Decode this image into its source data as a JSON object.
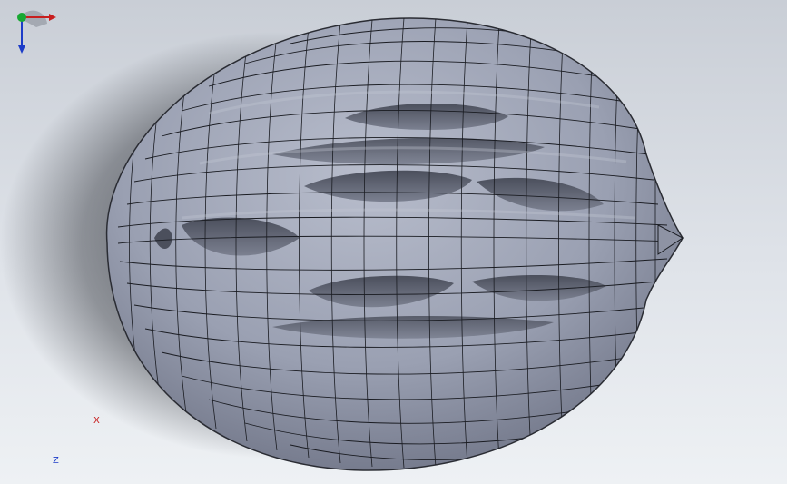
{
  "viewport": {
    "background_top": "#c9ced6",
    "background_bottom": "#eef1f4",
    "model": "helmet-mesh"
  },
  "model": {
    "surface_color": "#9aa0b2",
    "edge_color": "#1a1c22",
    "vent_color": "#5d6170"
  },
  "triad": {
    "x_label": "X",
    "z_label": "Z",
    "x_color": "#c81e1e",
    "y_color": "#17a832",
    "z_color": "#1c3cc8"
  }
}
